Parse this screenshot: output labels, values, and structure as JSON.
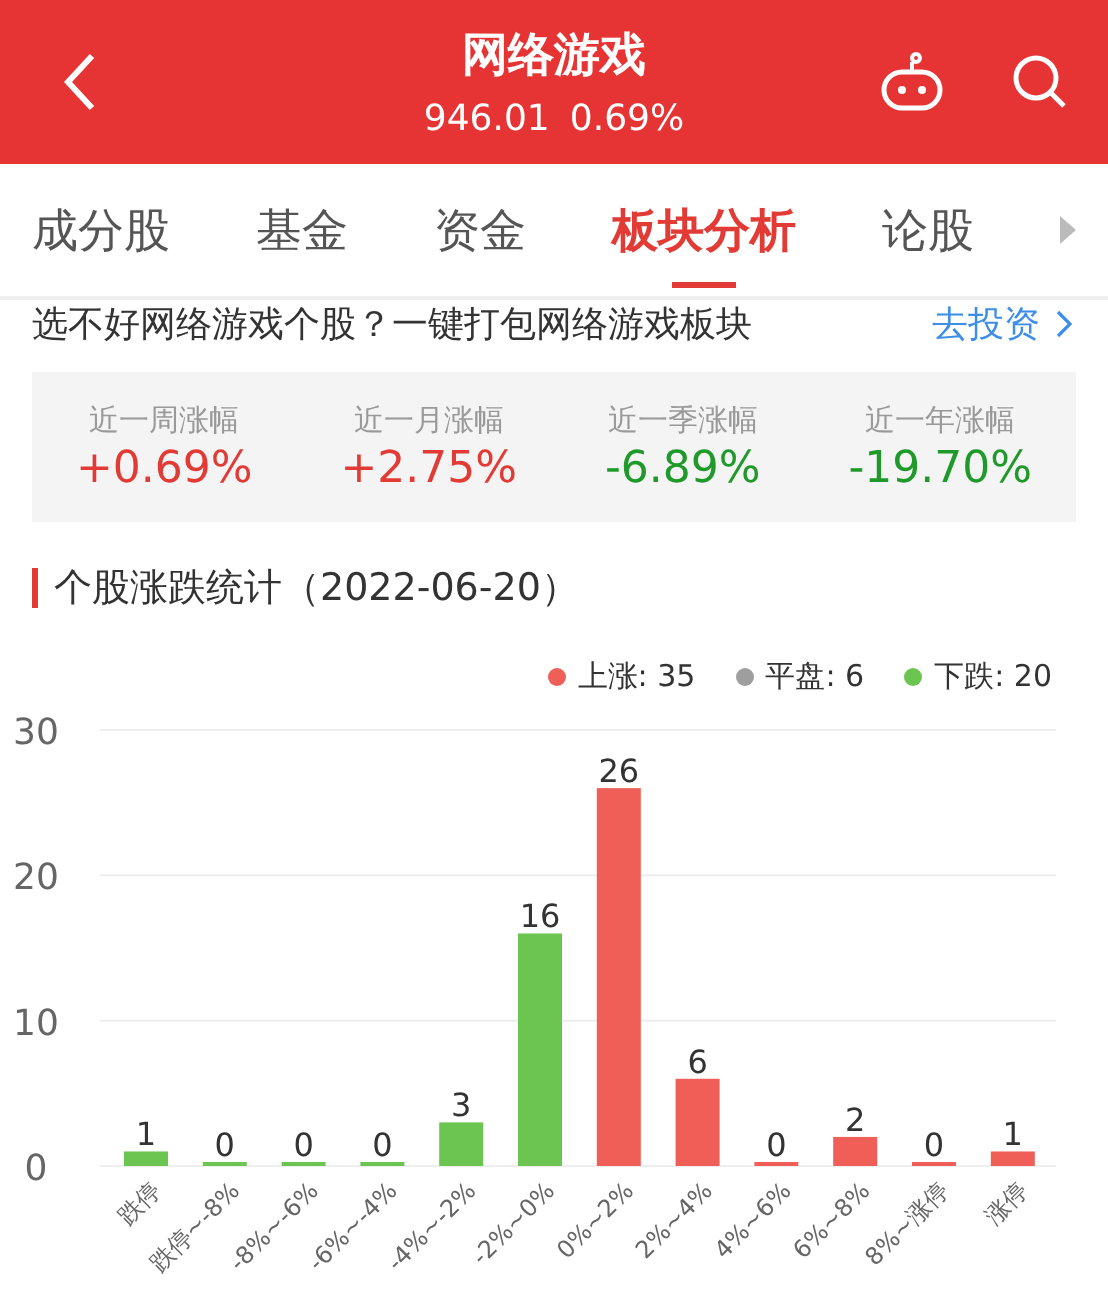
{
  "header": {
    "title": "网络游戏",
    "price": "946.01",
    "change": "0.69%"
  },
  "tabs": [
    {
      "label": "成分股",
      "selected": false
    },
    {
      "label": "基金",
      "selected": false
    },
    {
      "label": "资金",
      "selected": false
    },
    {
      "label": "板块分析",
      "selected": true
    },
    {
      "label": "论股",
      "selected": false
    }
  ],
  "promo": {
    "text": "选不好网络游戏个股？一键打包网络游戏板块",
    "link": "去投资"
  },
  "stats": [
    {
      "label": "近一周涨幅",
      "value": "+0.69%",
      "rising": true
    },
    {
      "label": "近一月涨幅",
      "value": "+2.75%",
      "rising": true
    },
    {
      "label": "近一季涨幅",
      "value": "-6.89%",
      "rising": false
    },
    {
      "label": "近一年涨幅",
      "value": "-19.70%",
      "rising": false
    }
  ],
  "section": {
    "title": "个股涨跌统计（2022-06-20）"
  },
  "legend": [
    {
      "label": "上涨: 35",
      "color": "#f05f57"
    },
    {
      "label": "平盘: 6",
      "color": "#9e9e9e"
    },
    {
      "label": "下跌: 20",
      "color": "#6cc551"
    }
  ],
  "chart_data": {
    "type": "bar",
    "categories": [
      "跌停",
      "跌停~-8%",
      "-8%~-6%",
      "-6%~-4%",
      "-4%~-2%",
      "-2%~0%",
      "0%~2%",
      "2%~4%",
      "4%~6%",
      "6%~8%",
      "8%~涨停",
      "涨停"
    ],
    "series": [
      {
        "color": "#6cc551",
        "values": [
          1,
          0,
          0,
          0,
          3,
          16,
          null,
          null,
          null,
          null,
          null,
          null
        ]
      },
      {
        "color": "#f05f57",
        "values": [
          null,
          null,
          null,
          null,
          null,
          null,
          26,
          6,
          0,
          2,
          0,
          1
        ]
      }
    ],
    "ylim": [
      0,
      30
    ],
    "yticks": [
      0,
      10,
      20,
      30
    ],
    "data_labels": true
  }
}
